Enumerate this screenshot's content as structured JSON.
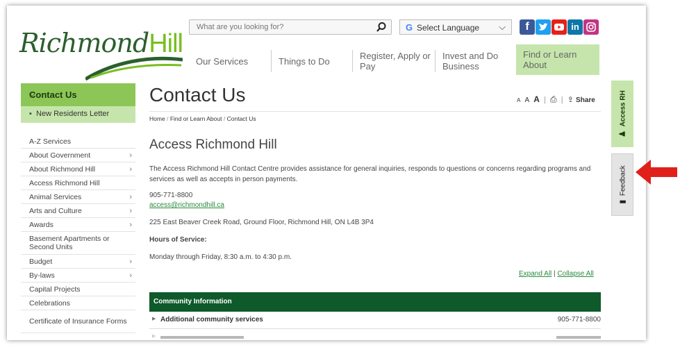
{
  "brand": {
    "logo_word1": "Richmond",
    "logo_word2": "Hill"
  },
  "search": {
    "placeholder": "What are you looking for?"
  },
  "language": {
    "label": "Select Language",
    "google_glyph": "G"
  },
  "social": [
    {
      "name": "facebook-icon",
      "glyph": "f",
      "color": "#3b5998"
    },
    {
      "name": "twitter-icon",
      "glyph": "t",
      "color": "#1da1f2"
    },
    {
      "name": "youtube-icon",
      "glyph": "▶",
      "color": "#e62117"
    },
    {
      "name": "linkedin-icon",
      "glyph": "in",
      "color": "#0e76a8"
    },
    {
      "name": "instagram-icon",
      "glyph": "◎",
      "color": "#c13584"
    }
  ],
  "nav": {
    "our_services": "Our Services",
    "things_to_do": "Things to Do",
    "register": "Register, Apply or Pay",
    "invest": "Invest and Do Business",
    "find_or_learn": "Find or Learn About"
  },
  "sidebar": {
    "heading": "Contact Us",
    "sub_item": "New Residents Letter",
    "items": [
      {
        "label": "A-Z Services",
        "arrow": ""
      },
      {
        "label": "About Government",
        "arrow": "›"
      },
      {
        "label": "About Richmond Hill",
        "arrow": "›"
      },
      {
        "label": "Access Richmond Hill",
        "arrow": ""
      },
      {
        "label": "Animal Services",
        "arrow": "›"
      },
      {
        "label": "Arts and Culture",
        "arrow": "›"
      },
      {
        "label": "Awards",
        "arrow": "›"
      },
      {
        "label": "Basement Apartments or Second Units",
        "arrow": ""
      },
      {
        "label": "Budget",
        "arrow": "›"
      },
      {
        "label": "By-laws",
        "arrow": "›"
      },
      {
        "label": "Capital Projects",
        "arrow": ""
      },
      {
        "label": "Celebrations",
        "arrow": ""
      },
      {
        "label": "Certificate of Insurance Forms",
        "arrow": ""
      }
    ]
  },
  "main": {
    "title": "Contact Us",
    "text_tools": {
      "a_small": "A",
      "a_medium": "A",
      "a_large": "A",
      "share": "Share"
    },
    "breadcrumb": {
      "home": "Home",
      "sep": "/",
      "find": "Find or Learn About",
      "current": "Contact Us"
    },
    "section_title": "Access Richmond Hill",
    "description": "The Access Richmond Hill Contact Centre provides assistance for general inquiries, responds to questions or concerns regarding programs and services as well as accepts in person payments.",
    "phone": "905-771-8800",
    "email": "access@richmondhill.ca",
    "address": "225 East Beaver Creek Road, Ground Floor, Richmond Hill, ON L4B 3P4",
    "hours_label": "Hours of Service:",
    "hours": "Monday through Friday, 8:30 a.m. to 4:30 p.m.",
    "expand_all": "Expand All",
    "expand_sep": "|",
    "collapse_all": "Collapse All",
    "community_heading": "Community Information",
    "accordion": [
      {
        "name": "Additional community services",
        "phone": "905-771-8800"
      }
    ]
  },
  "side_tabs": {
    "access": "Access RH",
    "feedback": "Feedback"
  },
  "colors": {
    "green_dark": "#0f5a2a",
    "green_light": "#c6e5ac",
    "green_mid": "#8cc657",
    "arrow_red": "#e0201b"
  }
}
